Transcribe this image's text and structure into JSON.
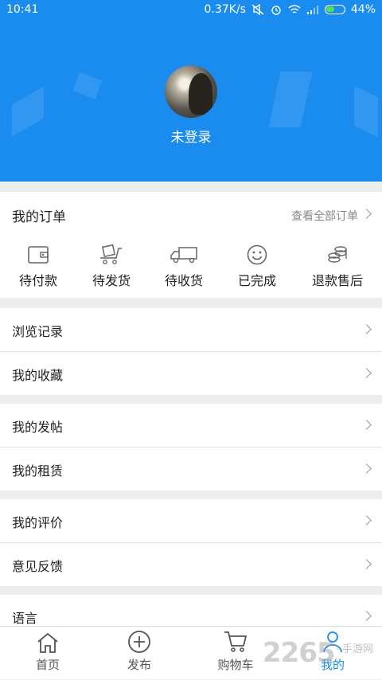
{
  "status_bar": {
    "time": "10:41",
    "network_speed": "0.37K/s",
    "battery": "44%"
  },
  "profile": {
    "username": "未登录"
  },
  "orders": {
    "title": "我的订单",
    "view_all": "查看全部订单",
    "items": [
      {
        "label": "待付款",
        "icon": "wallet-icon"
      },
      {
        "label": "待发货",
        "icon": "package-cart-icon"
      },
      {
        "label": "待收货",
        "icon": "truck-icon"
      },
      {
        "label": "已完成",
        "icon": "smile-icon"
      },
      {
        "label": "退款售后",
        "icon": "coins-icon"
      }
    ]
  },
  "menu": {
    "history": "浏览记录",
    "favorites": "我的收藏",
    "posts": "我的发帖",
    "rentals": "我的租赁",
    "reviews": "我的评价",
    "feedback": "意见反馈",
    "language": "语言"
  },
  "bottom_nav": {
    "items": [
      {
        "label": "首页",
        "icon": "home-icon"
      },
      {
        "label": "发布",
        "icon": "plus-circle-icon"
      },
      {
        "label": "购物车",
        "icon": "cart-icon"
      },
      {
        "label": "我的",
        "icon": "person-icon"
      }
    ],
    "active": "我的"
  },
  "watermark": {
    "number": "2265",
    "text": "手游网"
  },
  "colors": {
    "primary": "#1a8cf0",
    "background": "#ededed"
  }
}
